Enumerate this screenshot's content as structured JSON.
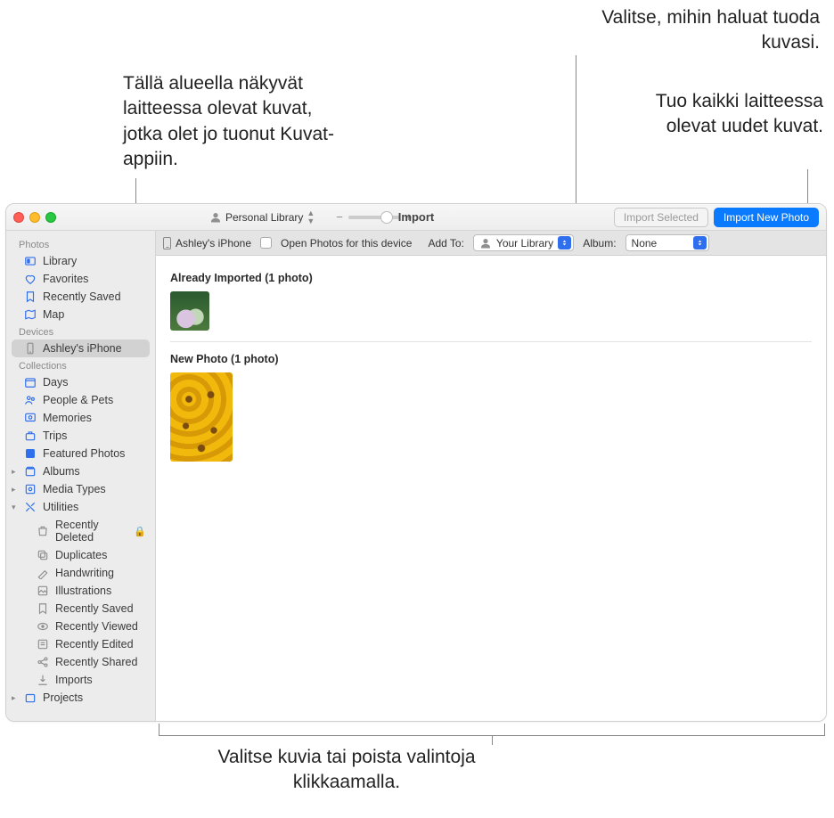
{
  "callouts": {
    "c1": "Tällä alueella näkyvät laitteessa olevat kuvat, jotka olet jo tuonut Kuvat-appiin.",
    "c2": "Valitse, mihin haluat tuoda kuvasi.",
    "c3": "Tuo kaikki laitteessa olevat uudet kuvat.",
    "c4": "Valitse kuvia tai poista valintoja klikkaamalla."
  },
  "titlebar": {
    "library": "Personal Library",
    "title": "Import",
    "importSelected": "Import Selected",
    "importNew": "Import New Photo"
  },
  "deviceBar": {
    "device": "Ashley's iPhone",
    "openPhotos": "Open Photos for this device",
    "addToLabel": "Add To:",
    "addToValue": "Your Library",
    "albumLabel": "Album:",
    "albumValue": "None"
  },
  "sidebar": {
    "secPhotos": "Photos",
    "library": "Library",
    "favorites": "Favorites",
    "recentlySaved": "Recently Saved",
    "map": "Map",
    "secDevices": "Devices",
    "deviceItem": "Ashley's iPhone",
    "secCollections": "Collections",
    "days": "Days",
    "peoplePets": "People & Pets",
    "memories": "Memories",
    "trips": "Trips",
    "featured": "Featured Photos",
    "albums": "Albums",
    "mediaTypes": "Media Types",
    "utilities": "Utilities",
    "recentlyDeleted": "Recently Deleted",
    "duplicates": "Duplicates",
    "handwriting": "Handwriting",
    "illustrations": "Illustrations",
    "recentlySaved2": "Recently Saved",
    "recentlyViewed": "Recently Viewed",
    "recentlyEdited": "Recently Edited",
    "recentlyShared": "Recently Shared",
    "imports": "Imports",
    "projects": "Projects"
  },
  "content": {
    "already": "Already Imported (1 photo)",
    "newp": "New Photo (1 photo)"
  }
}
